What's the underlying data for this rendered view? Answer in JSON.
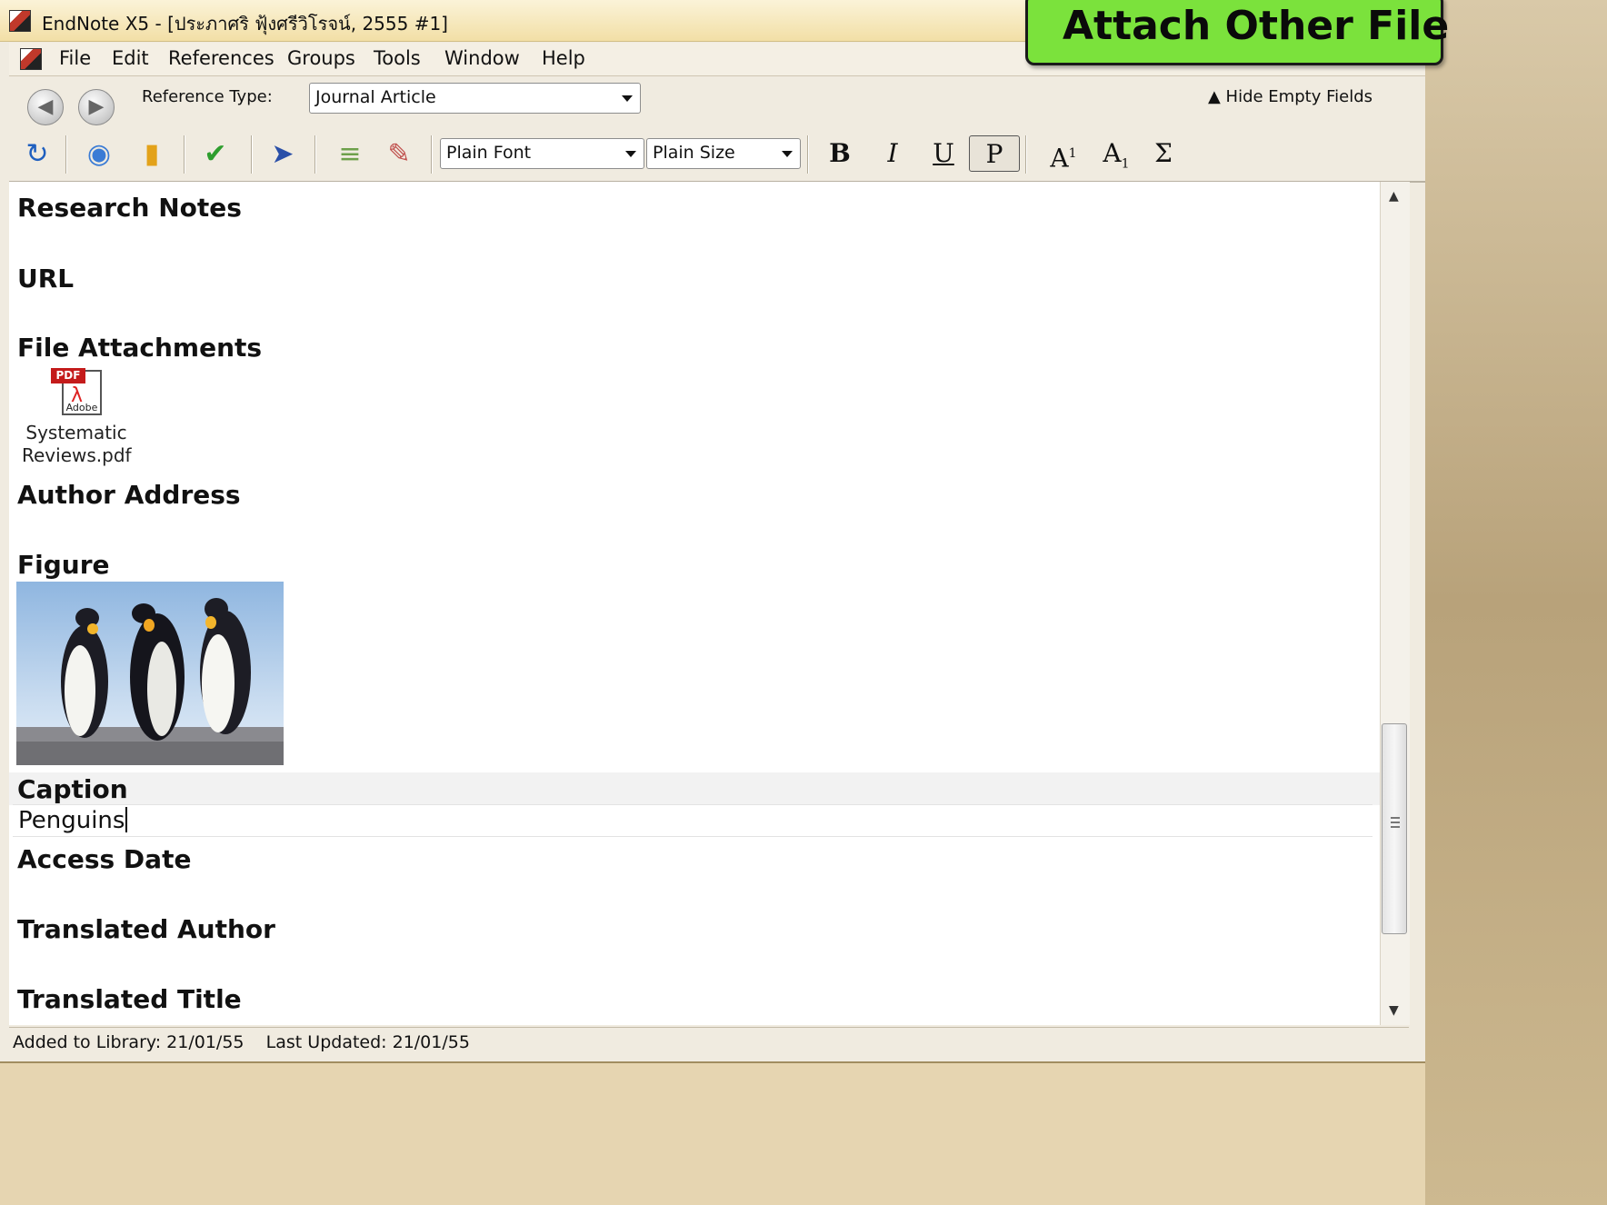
{
  "window": {
    "title": "EndNote X5 - [ประภาศริ ฟุ้งศรีวิโรจน์, 2555 #1]"
  },
  "callout": {
    "text": "Attach Other File"
  },
  "menu": {
    "items": [
      "File",
      "Edit",
      "References",
      "Groups",
      "Tools",
      "Window",
      "Help"
    ]
  },
  "toolbar": {
    "reference_type_label": "Reference Type:",
    "reference_type_value": "Journal Article",
    "hide_empty_fields": "Hide Empty Fields",
    "font_value": "Plain Font",
    "size_value": "Plain Size",
    "bold": "B",
    "italic": "I",
    "underline": "U",
    "plain": "P",
    "superscript_base": "A",
    "superscript_mark": "1",
    "subscript_base": "A",
    "subscript_mark": "1",
    "symbol": "Σ"
  },
  "fields": {
    "research_notes": "Research Notes",
    "url": "URL",
    "file_attachments": "File Attachments",
    "author_address": "Author Address",
    "figure": "Figure",
    "caption": "Caption",
    "caption_value": "Penguins",
    "access_date": "Access Date",
    "translated_author": "Translated Author",
    "translated_title": "Translated Title"
  },
  "attachment": {
    "badge": "PDF",
    "brand": "Adobe",
    "name_line1": "Systematic",
    "name_line2": "Reviews.pdf"
  },
  "status": {
    "text": "Added to Library: 21/01/55    Last Updated: 21/01/55"
  },
  "icons": [
    "app-icon",
    "back-icon",
    "forward-icon",
    "sync-icon",
    "online-search-icon",
    "open-folder-icon",
    "spellcheck-icon",
    "pin-icon",
    "list-icon",
    "edit-icon",
    "hide-fields-arrow-icon",
    "pdf-file-icon"
  ]
}
